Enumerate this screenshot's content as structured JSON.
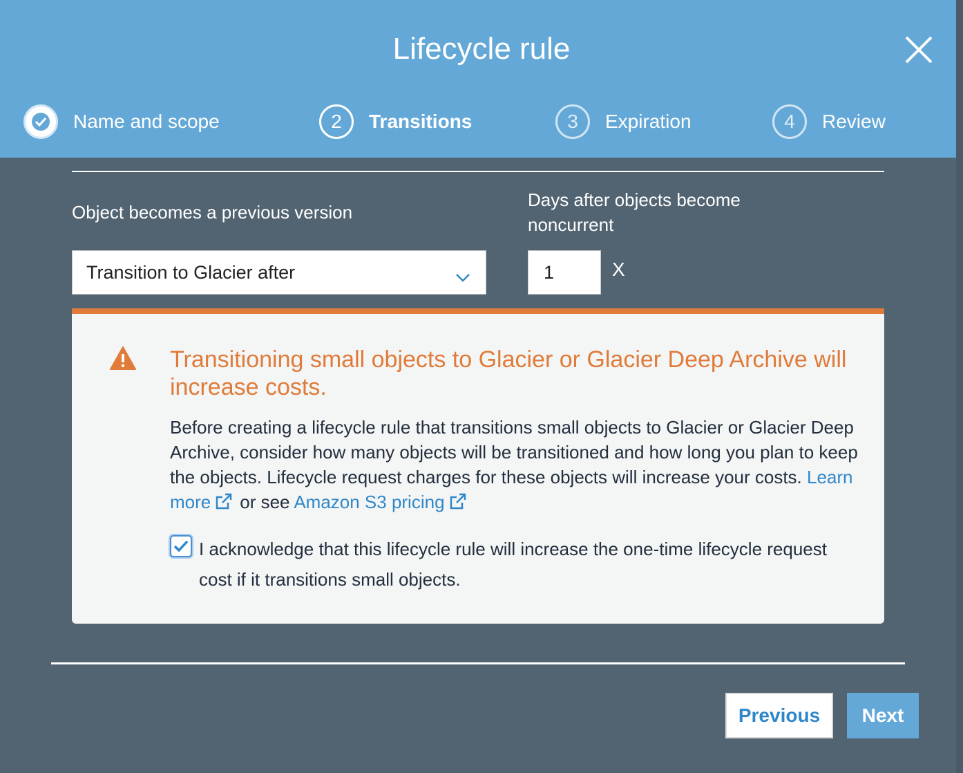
{
  "modal": {
    "title": "Lifecycle rule",
    "close_icon": "close-icon"
  },
  "steps": [
    {
      "number": "",
      "label": "Name and scope",
      "state": "completed",
      "icon": "check-circle-icon"
    },
    {
      "number": "2",
      "label": "Transitions",
      "state": "active"
    },
    {
      "number": "3",
      "label": "Expiration",
      "state": "inactive"
    },
    {
      "number": "4",
      "label": "Review",
      "state": "inactive"
    }
  ],
  "transition": {
    "type_label": "Object becomes a previous version",
    "selected_option": "Transition to Glacier after",
    "days_label": "Days after objects become noncurrent",
    "days_value": "1",
    "remove_label": "X"
  },
  "alert": {
    "title": "Transitioning small objects to Glacier or Glacier Deep Archive will increase costs.",
    "body": "Before creating a lifecycle rule that transitions small objects to Glacier or Glacier Deep Archive, consider how many objects will be transitioned and how long you plan to keep the objects. Lifecycle request charges for these objects will increase your costs.",
    "learn_more": "Learn more",
    "or_see": "or see",
    "pricing_link": "Amazon S3 pricing",
    "acknowledge_checked": true,
    "acknowledge_text": "I acknowledge that this lifecycle rule will increase the one-time lifecycle request cost if it transitions small objects."
  },
  "footer": {
    "previous_label": "Previous",
    "next_label": "Next"
  },
  "colors": {
    "header": "#64a8d8",
    "background": "#526371",
    "warning": "#e07b39",
    "link": "#2f87c9"
  }
}
